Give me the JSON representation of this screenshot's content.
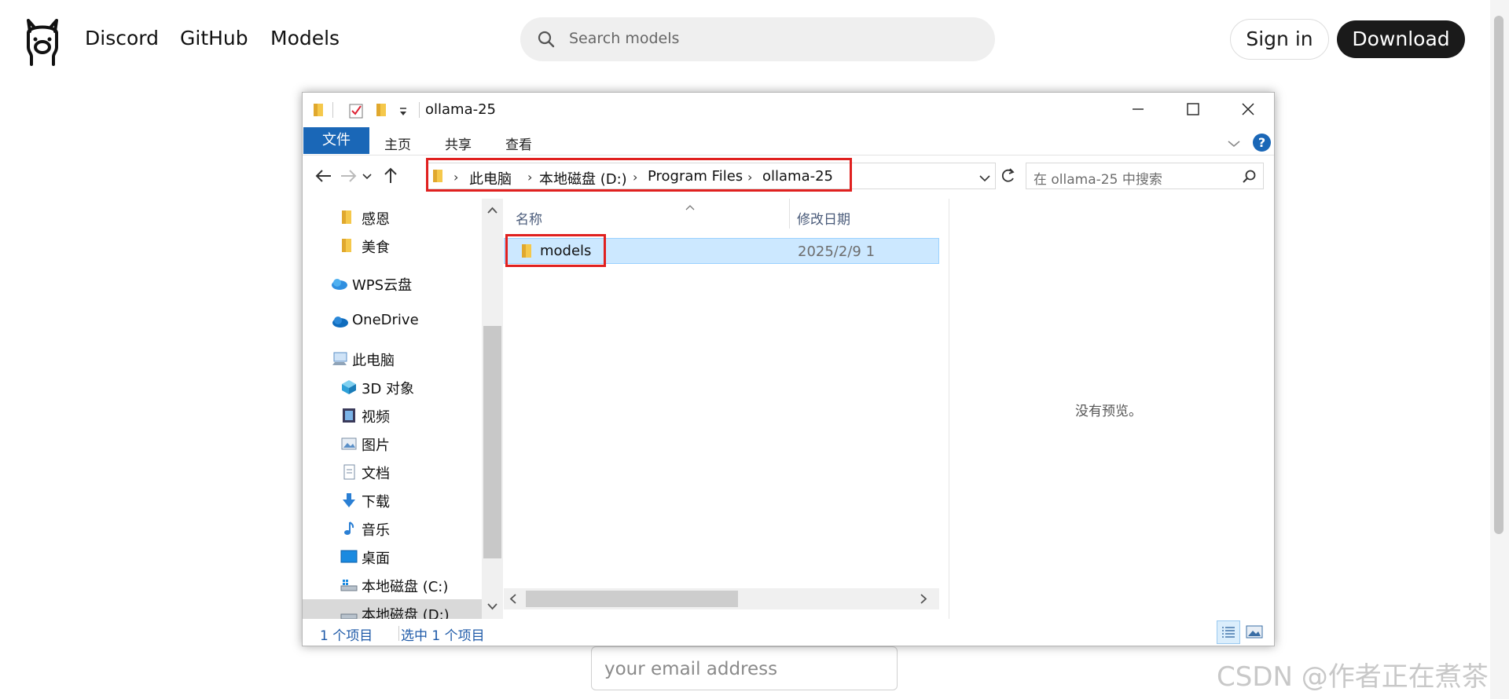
{
  "web": {
    "nav_links": [
      "Discord",
      "GitHub",
      "Models"
    ],
    "search_placeholder": "Search models",
    "signin_label": "Sign in",
    "download_label": "Download",
    "email_placeholder": "your email address",
    "watermark": "CSDN @作者正在煮茶"
  },
  "explorer": {
    "window_title": "ollama-25",
    "ribbon_tabs": [
      "文件",
      "主页",
      "共享",
      "查看"
    ],
    "breadcrumb": [
      "此电脑",
      "本地磁盘 (D:)",
      "Program Files",
      "ollama-25"
    ],
    "search_placeholder": "在 ollama-25 中搜索",
    "nav_pane": [
      "感恩",
      "美食",
      "WPS云盘",
      "OneDrive",
      "此电脑",
      "3D 对象",
      "视频",
      "图片",
      "文档",
      "下载",
      "音乐",
      "桌面",
      "本地磁盘 (C:)",
      "本地磁盘 (D:)"
    ],
    "columns": [
      "名称",
      "修改日期"
    ],
    "files": [
      {
        "name": "models",
        "date": "2025/2/9 1"
      }
    ],
    "preview_text": "没有预览。",
    "status": [
      "1 个项目",
      "选中 1 个项目"
    ]
  },
  "colors": {
    "highlight_red": "#e0201f",
    "ribbon_blue": "#1a67b7",
    "selection_blue": "#cce8ff"
  }
}
